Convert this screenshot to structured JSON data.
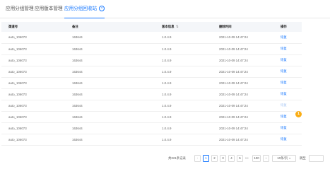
{
  "tabs": [
    {
      "label": "应用分组管理",
      "active": false
    },
    {
      "label": "应用版本管理",
      "active": false
    },
    {
      "label": "应用分组回收站",
      "active": true,
      "help_icon": "?"
    }
  ],
  "table": {
    "headers": {
      "col1": "渠道号",
      "col2": "备注",
      "col3": "版本信息",
      "col3_sort_icon": "⇅",
      "col4": "删除时间",
      "col5": "操作"
    },
    "rows": [
      {
        "channel": "auto_106073",
        "remark": "163644",
        "version": "1.0.4.9",
        "deleted_at": "2021-10-09 14:47:24",
        "action": "恢复"
      },
      {
        "channel": "auto_106073",
        "remark": "163644",
        "version": "1.0.4.9",
        "deleted_at": "2021-10-09 14:47:24",
        "action": "恢复"
      },
      {
        "channel": "auto_106073",
        "remark": "163644",
        "version": "1.0.4.9",
        "deleted_at": "2021-10-09 14:47:24",
        "action": "恢复"
      },
      {
        "channel": "auto_106073",
        "remark": "163644",
        "version": "1.0.4.9",
        "deleted_at": "2021-10-09 14:47:24",
        "action": "恢复"
      },
      {
        "channel": "auto_106073",
        "remark": "163644",
        "version": "1.0.4.9",
        "deleted_at": "2021-10-09 14:47:24",
        "action": "恢复"
      },
      {
        "channel": "auto_106073",
        "remark": "163644",
        "version": "1.0.4.9",
        "deleted_at": "2021-10-09 14:47:24",
        "action": "恢复"
      },
      {
        "channel": "auto_106073",
        "remark": "163644",
        "version": "1.0.4.9",
        "deleted_at": "2021-10-09 14:47:24",
        "action": "恢复"
      },
      {
        "channel": "auto_106073",
        "remark": "163644",
        "version": "1.0.4.9",
        "deleted_at": "2021-10-09 14:47:24",
        "action": "恢复"
      },
      {
        "channel": "auto_106073",
        "remark": "163644",
        "version": "1.0.4.9",
        "deleted_at": "2021-10-09 14:47:24",
        "action": "恢复"
      },
      {
        "channel": "auto_106073",
        "remark": "163644",
        "version": "1.0.4.9",
        "deleted_at": "2021-10-09 14:47:24",
        "action": "恢复"
      }
    ],
    "badge": "1"
  },
  "pagination": {
    "total_text": "共321条记录",
    "prev": "‹",
    "pages": [
      "1",
      "2",
      "3",
      "4",
      "5"
    ],
    "ellipsis": "•••",
    "last_page": "100",
    "next": "›",
    "page_size": "10条/页",
    "page_size_caret": "▼",
    "jump_label": "跳至",
    "jump_value": ""
  },
  "colors": {
    "accent": "#1677ff",
    "badge": "#faad14",
    "header_bg": "#f4f6f9"
  }
}
